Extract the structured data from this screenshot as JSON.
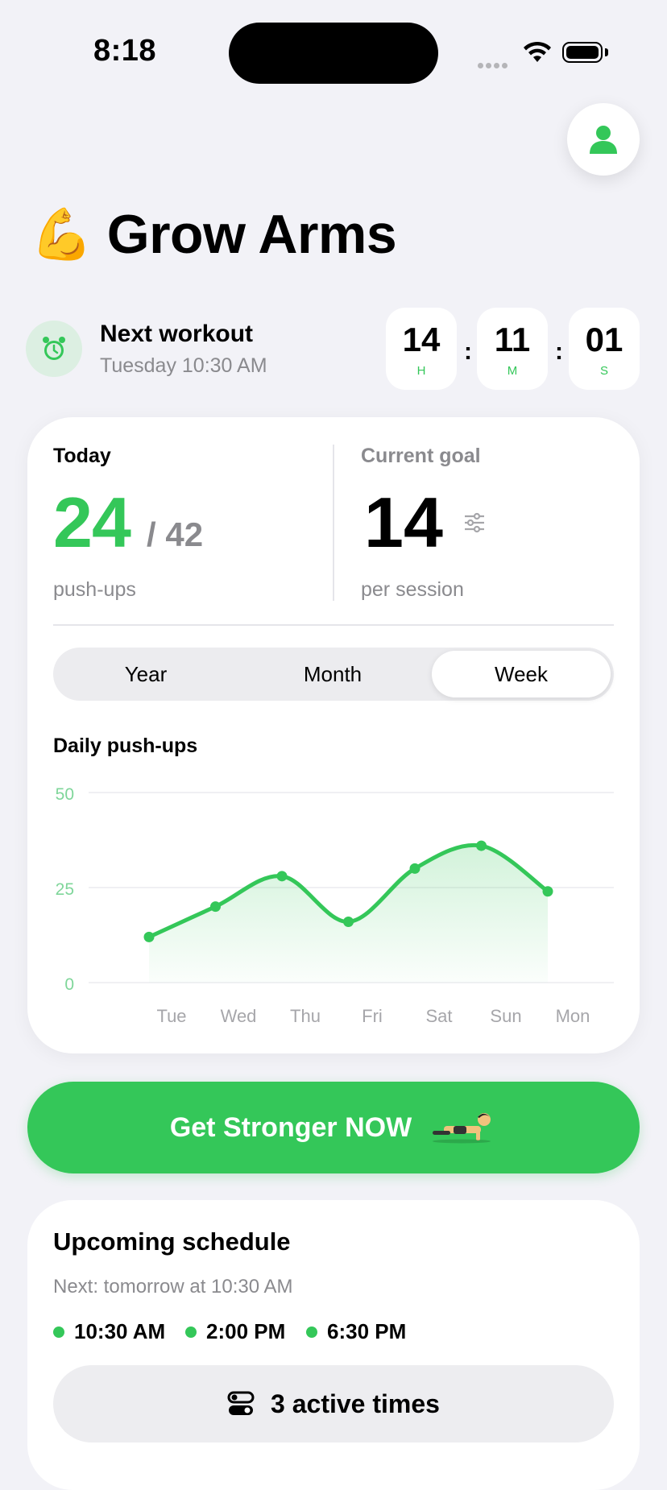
{
  "status_bar": {
    "time": "8:18"
  },
  "app": {
    "title": "Grow Arms",
    "title_emoji": "💪"
  },
  "next_workout": {
    "label": "Next workout",
    "datetime": "Tuesday 10:30 AM",
    "countdown": {
      "hours": "14",
      "minutes": "11",
      "seconds": "01",
      "hours_unit": "H",
      "minutes_unit": "M",
      "seconds_unit": "S",
      "separator": ":"
    }
  },
  "today": {
    "label": "Today",
    "count": "24",
    "total": "/ 42",
    "unit": "push-ups"
  },
  "goal": {
    "label": "Current goal",
    "value": "14",
    "unit": "per session"
  },
  "period_tabs": [
    {
      "label": "Year",
      "active": false
    },
    {
      "label": "Month",
      "active": false
    },
    {
      "label": "Week",
      "active": true
    }
  ],
  "chart_title": "Daily push-ups",
  "chart_data": {
    "type": "area",
    "title": "Daily push-ups",
    "categories": [
      "Tue",
      "Wed",
      "Thu",
      "Fri",
      "Sat",
      "Sun",
      "Mon"
    ],
    "values": [
      12,
      20,
      28,
      16,
      30,
      36,
      24
    ],
    "ylim": [
      0,
      50
    ],
    "yticks": [
      0,
      25,
      50
    ],
    "grid": true,
    "color": "#34c759"
  },
  "cta": {
    "label": "Get Stronger NOW",
    "emoji": "🏋️"
  },
  "schedule": {
    "title": "Upcoming schedule",
    "next": "Next: tomorrow at 10:30 AM",
    "times": [
      "10:30 AM",
      "2:00 PM",
      "6:30 PM"
    ],
    "active_label": "3 active times"
  },
  "colors": {
    "accent": "#34c759",
    "background": "#f2f2f7",
    "muted": "#8a8a8e"
  }
}
